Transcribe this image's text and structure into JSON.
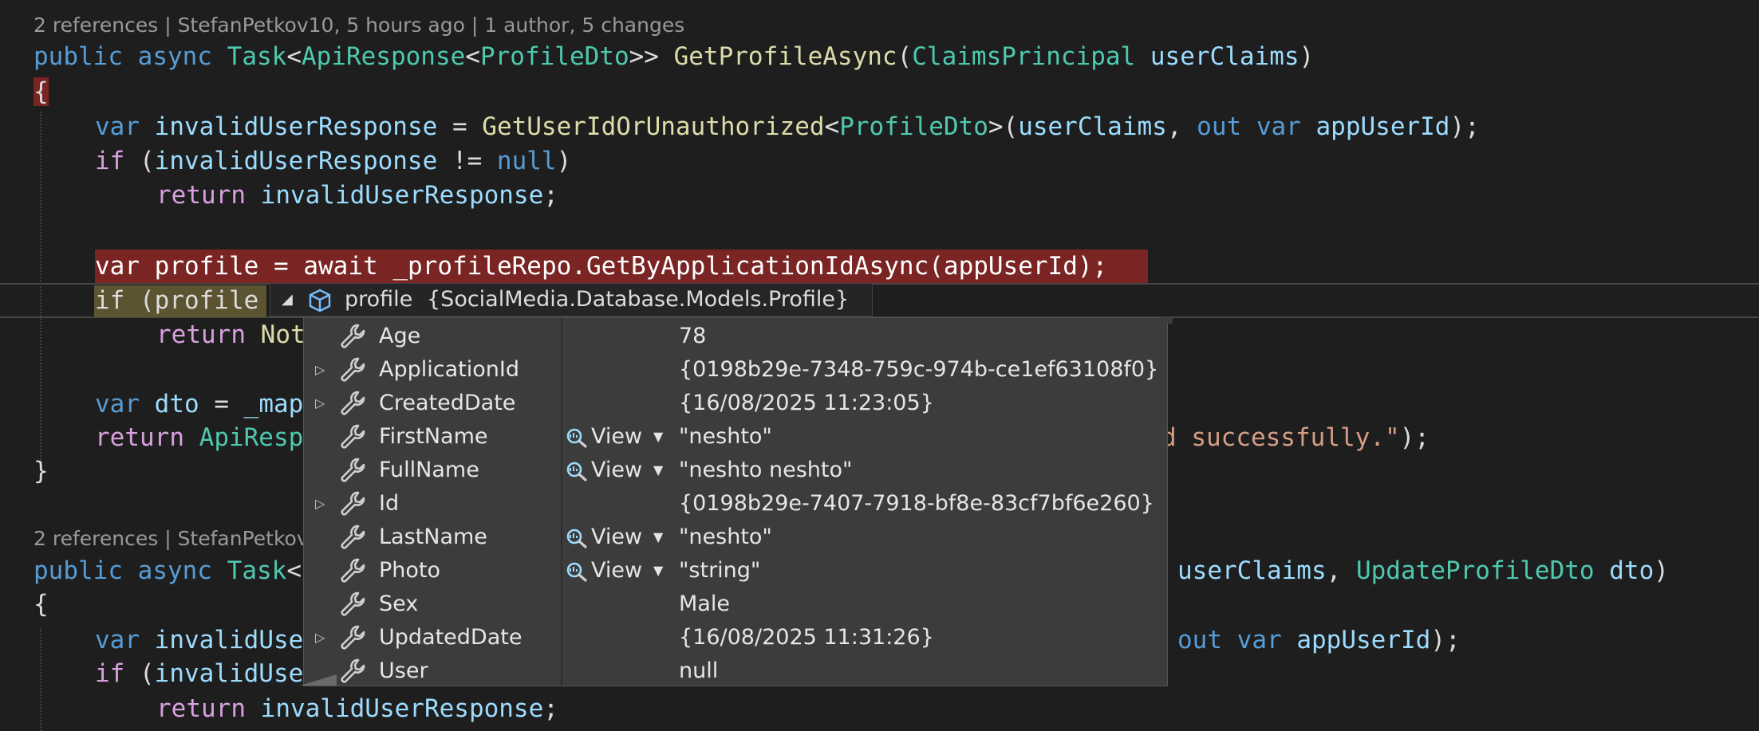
{
  "code_lens": {
    "top": "2 references | StefanPetkov10, 5 hours ago | 1 author, 5 changes",
    "bottom": "2 references | StefanPetkov"
  },
  "code": {
    "l1": {
      "a": "public",
      "b": " ",
      "c": "async",
      "d": " ",
      "e": "Task",
      "f": "<",
      "g": "ApiResponse",
      "h": "<",
      "i": "ProfileDto",
      "j": ">> ",
      "k": "GetProfileAsync",
      "l": "(",
      "m": "ClaimsPrincipal",
      "n": " ",
      "o": "userClaims",
      "p": ")"
    },
    "l2": "{",
    "l3": {
      "a": "var",
      "b": " ",
      "c": "invalidUserResponse",
      "d": " = ",
      "e": "GetUserIdOrUnauthorized",
      "f": "<",
      "g": "ProfileDto",
      "h": ">(",
      "i": "userClaims",
      "j": ", ",
      "k": "out",
      "l": " ",
      "m": "var",
      "n": " ",
      "o": "appUserId",
      "p": ");"
    },
    "l4": {
      "a": "if",
      "b": " (",
      "c": "invalidUserResponse",
      "d": " != ",
      "e": "null",
      "f": ")"
    },
    "l5": {
      "a": "return",
      "b": " ",
      "c": "invalidUserResponse",
      "d": ";"
    },
    "l6": {
      "a": "var",
      "b": " ",
      "c": "profile",
      "d": " = ",
      "e": "await",
      "f": " ",
      "g": "_profileRepo",
      "h": ".",
      "i": "GetByApplicationIdAsync",
      "j": "(",
      "k": "appUserId",
      "l": ");"
    },
    "l7": {
      "a": "if",
      "b": " (",
      "c": "profile"
    },
    "l8": {
      "a": "return",
      "b": " ",
      "c": "Not"
    },
    "l9": {
      "a": "var",
      "b": " ",
      "c": "dto",
      "d": " = ",
      "e": "_map"
    },
    "l10": {
      "a": "return",
      "b": " ",
      "c": "ApiResp",
      "d": "d successfully.\"",
      "e": ");"
    },
    "l11": "}",
    "l12": {
      "a": "public",
      "b": " ",
      "c": "async",
      "d": " ",
      "e": "Task",
      "f": "<",
      "g": "userClaims",
      "h": ", ",
      "i": "UpdateProfileDto",
      "j": " ",
      "k": "dto",
      "l": ")"
    },
    "l13": "{",
    "l14": {
      "a": "var",
      "b": " ",
      "c": "invalidUse",
      "d": "out",
      "e": " ",
      "f": "var",
      "g": " ",
      "h": "appUserId",
      "i": ");"
    },
    "l15": {
      "a": "if",
      "b": " (",
      "c": "invalidUse"
    },
    "l16": {
      "a": "return",
      "b": " ",
      "c": "invalidUserResponse",
      "d": ";"
    }
  },
  "datatip": {
    "header": {
      "collapse_glyph": "◢",
      "name": "profile",
      "value": "{SocialMedia.Database.Models.Profile}"
    },
    "expander_glyph": "▷",
    "viewer_label": "View",
    "viewer_caret": "▼",
    "rows": [
      {
        "name": "Age",
        "value": "78"
      },
      {
        "name": "ApplicationId",
        "value": "{0198b29e-7348-759c-974b-ce1ef63108f0}"
      },
      {
        "name": "CreatedDate",
        "value": "{16/08/2025 11:23:05}"
      },
      {
        "name": "FirstName",
        "value": "\"neshto\""
      },
      {
        "name": "FullName",
        "value": "\"neshto neshto\""
      },
      {
        "name": "Id",
        "value": "{0198b29e-7407-7918-bf8e-83cf7bf6e260}"
      },
      {
        "name": "LastName",
        "value": "\"neshto\""
      },
      {
        "name": "Photo",
        "value": "\"string\""
      },
      {
        "name": "Sex",
        "value": "Male"
      },
      {
        "name": "UpdatedDate",
        "value": "{16/08/2025 11:31:26}"
      },
      {
        "name": "User",
        "value": "null"
      }
    ]
  },
  "colors": {
    "background": "#1e1e1e",
    "keyword": "#569cd6",
    "control": "#d8a0df",
    "type": "#4ec9b0",
    "method": "#dcdcaa",
    "identifier": "#9cdcfe",
    "string": "#d69d85",
    "breakpoint": "#7a2424",
    "datatip_bg": "#3c3c3c"
  }
}
